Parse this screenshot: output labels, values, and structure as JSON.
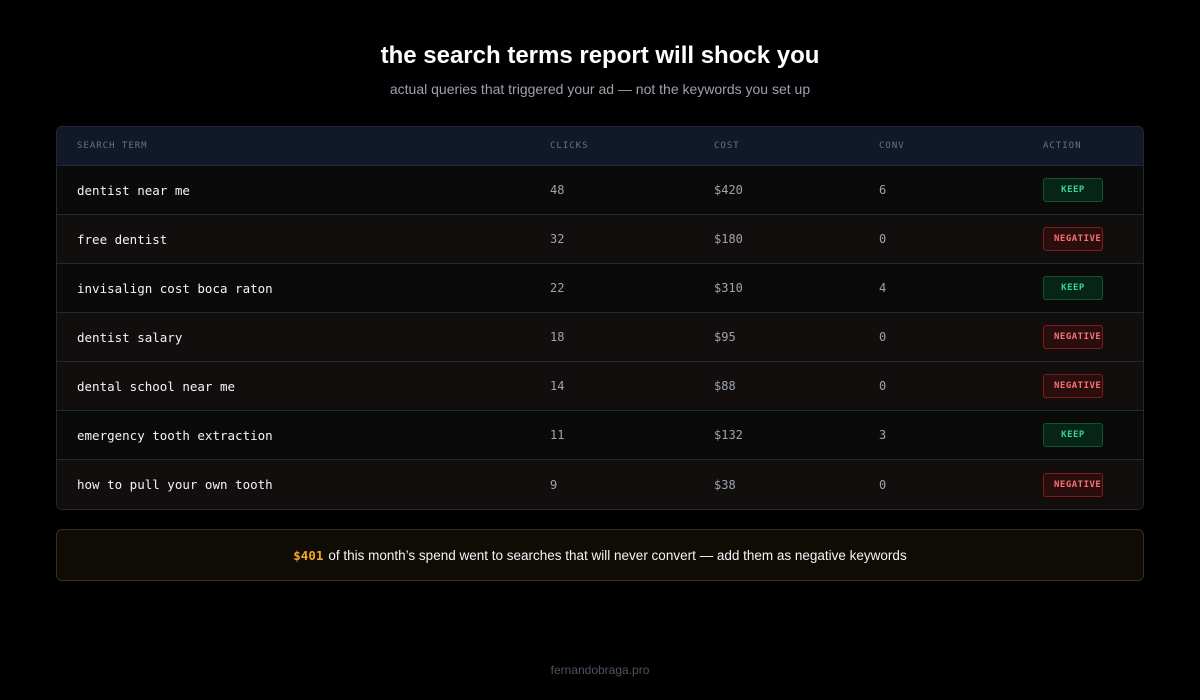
{
  "header": {
    "title": "the search terms report will shock you",
    "subtitle": "actual queries that triggered your ad — not the keywords you set up"
  },
  "table": {
    "columns": [
      "SEARCH TERM",
      "CLICKS",
      "COST",
      "CONV",
      "ACTION"
    ],
    "rows": [
      {
        "term": "dentist near me",
        "clicks": "48",
        "cost": "$420",
        "conv": "6",
        "action": "KEEP",
        "status": "keep"
      },
      {
        "term": "free dentist",
        "clicks": "32",
        "cost": "$180",
        "conv": "0",
        "action": "NEGATIVE",
        "status": "negative"
      },
      {
        "term": "invisalign cost boca raton",
        "clicks": "22",
        "cost": "$310",
        "conv": "4",
        "action": "KEEP",
        "status": "keep"
      },
      {
        "term": "dentist salary",
        "clicks": "18",
        "cost": "$95",
        "conv": "0",
        "action": "NEGATIVE",
        "status": "negative"
      },
      {
        "term": "dental school near me",
        "clicks": "14",
        "cost": "$88",
        "conv": "0",
        "action": "NEGATIVE",
        "status": "negative"
      },
      {
        "term": "emergency tooth extraction",
        "clicks": "11",
        "cost": "$132",
        "conv": "3",
        "action": "KEEP",
        "status": "keep"
      },
      {
        "term": "how to pull your own tooth",
        "clicks": "9",
        "cost": "$38",
        "conv": "0",
        "action": "NEGATIVE",
        "status": "negative"
      }
    ]
  },
  "callout": {
    "amount": "$401",
    "text": "of this month’s spend went to searches that will never convert — add them as negative keywords"
  },
  "footer": {
    "text": "fernandobraga.pro"
  },
  "colors": {
    "keep": "#34d399",
    "negative": "#f87171",
    "accent": "#f5a623"
  }
}
